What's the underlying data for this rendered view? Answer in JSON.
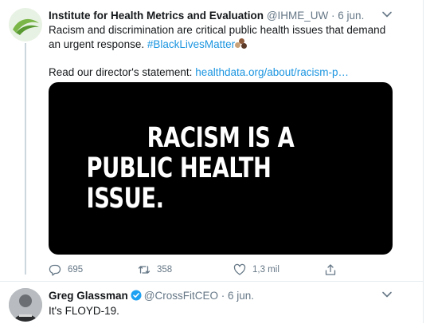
{
  "tweets": [
    {
      "author": {
        "display_name": "Institute for Health Metrics and Evaluation",
        "handle": "@IHME_UW",
        "date": "· 6 jun."
      },
      "text": {
        "line1": "Racism and discrimination are critical public health issues that demand an urgent response.",
        "hashtag": "#BlackLivesMatter",
        "statement_prefix": "Read our director's statement:",
        "link": "healthdata.org/about/racism-p…"
      },
      "media": {
        "line1": "RACISM IS A",
        "line2": "PUBLIC HEALTH ISSUE."
      },
      "actions": {
        "replies": "695",
        "retweets": "358",
        "likes": "1,3 mil"
      },
      "icons": {
        "reply": "reply-icon",
        "retweet": "retweet-icon",
        "like": "heart-icon",
        "share": "share-icon",
        "menu": "chevron-down-icon"
      }
    },
    {
      "author": {
        "display_name": "Greg Glassman",
        "handle": "@CrossFitCEO",
        "date": "· 6 jun."
      },
      "text": "It's FLOYD-19.",
      "verified": true
    }
  ],
  "colors": {
    "link": "#1b95e0",
    "muted": "#657786",
    "border": "#e6ecf0",
    "thread_line": "#ccd6dd"
  }
}
